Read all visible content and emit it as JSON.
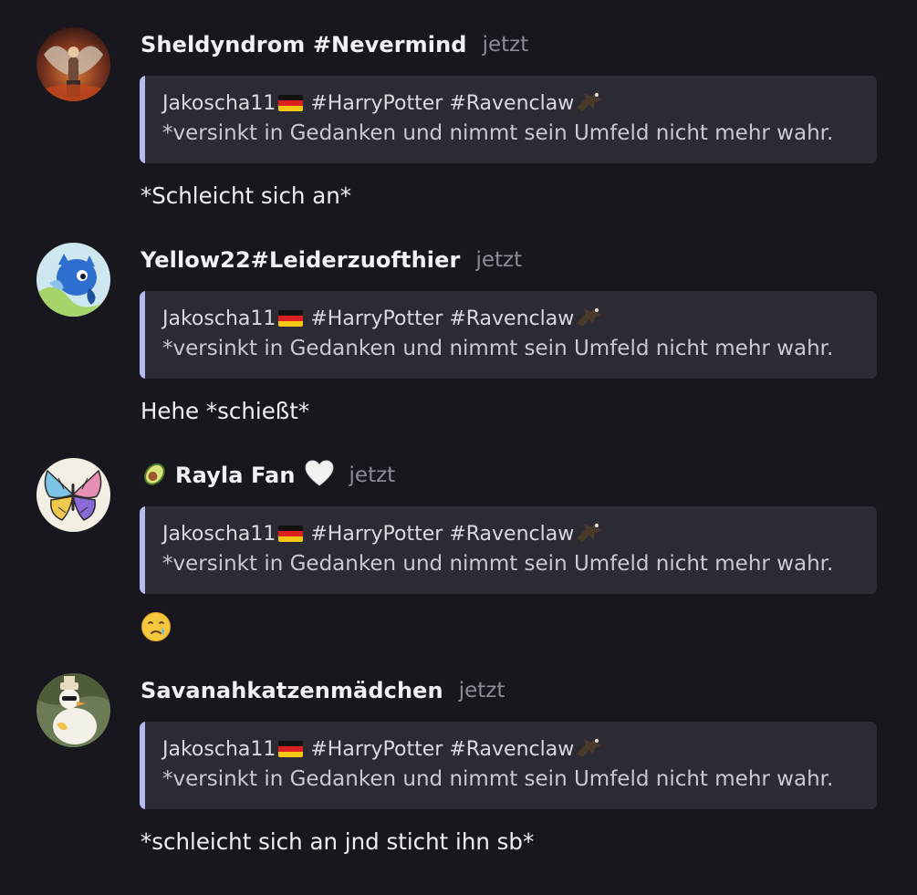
{
  "messages": [
    {
      "username": "Sheldyndrom #Nevermind",
      "time": "jetzt",
      "quote": {
        "author": "Jakoscha11",
        "tags": "#HarryPotter #Ravenclaw",
        "text": "*versinkt in Gedanken und nimmt sein Umfeld nicht mehr wahr."
      },
      "body": "*Schleicht sich an*"
    },
    {
      "username": "Yellow22#Leiderzuofthier",
      "time": "jetzt",
      "quote": {
        "author": "Jakoscha11",
        "tags": "#HarryPotter #Ravenclaw",
        "text": "*versinkt in Gedanken und nimmt sein Umfeld nicht mehr wahr."
      },
      "body": "Hehe *schießt*"
    },
    {
      "username": "Rayla Fan",
      "time": "jetzt",
      "quote": {
        "author": "Jakoscha11",
        "tags": "#HarryPotter #Ravenclaw",
        "text": "*versinkt in Gedanken und nimmt sein Umfeld nicht mehr wahr."
      },
      "body": ""
    },
    {
      "username": "Savanahkatzenmädchen",
      "time": "jetzt",
      "quote": {
        "author": "Jakoscha11",
        "tags": "#HarryPotter #Ravenclaw",
        "text": "*versinkt in Gedanken und nimmt sein Umfeld nicht mehr wahr."
      },
      "body": "*schleicht sich an jnd sticht ihn sb*"
    }
  ],
  "icons": {
    "quote_author_flag": "german-flag-icon",
    "quote_author_bird": "eagle-icon",
    "username_prefix_rayla": "avocado-icon",
    "username_suffix_rayla": "white-heart-icon",
    "body_emoji_rayla": "crying-face-icon"
  },
  "colors": {
    "background": "#17171d",
    "quote_background": "#2b2b33",
    "quote_bar": "#b6baf3",
    "timestamp": "#8c8c96"
  }
}
